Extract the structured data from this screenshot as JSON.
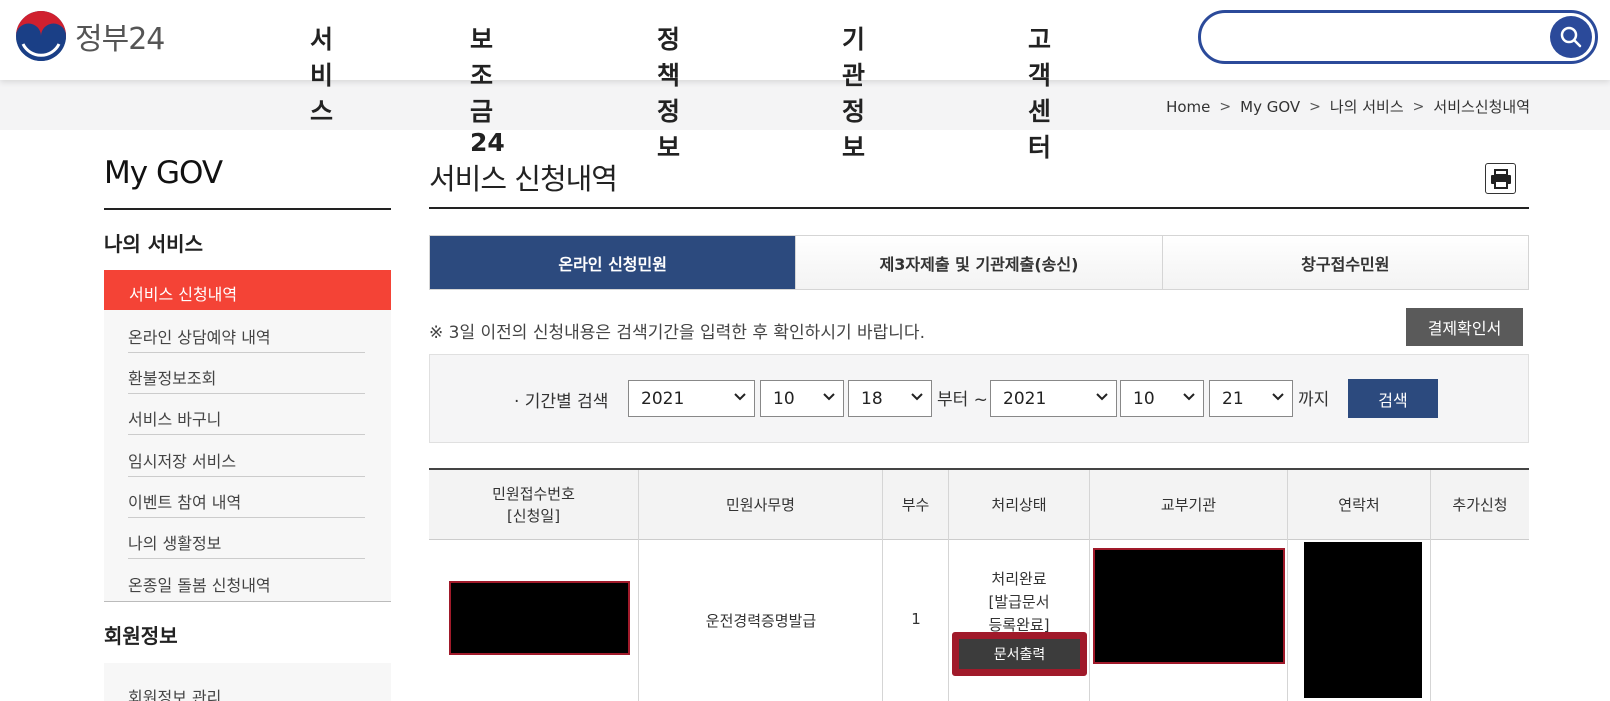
{
  "header": {
    "logo_text": "정부24",
    "nav": [
      "서비스",
      "보조금24",
      "정책정보",
      "기관정보",
      "고객센터"
    ],
    "search_placeholder": ""
  },
  "breadcrumb": [
    "Home",
    "My GOV",
    "나의 서비스",
    "서비스신청내역"
  ],
  "sidebar": {
    "title": "My GOV",
    "section1": "나의 서비스",
    "active_item": "서비스 신청내역",
    "items": [
      "온라인 상담예약 내역",
      "환불정보조회",
      "서비스 바구니",
      "임시저장 서비스",
      "이벤트 참여 내역",
      "나의 생활정보",
      "온종일 돌봄 신청내역"
    ],
    "section2": "회원정보",
    "section2_items": [
      "회원정보 관리"
    ]
  },
  "main": {
    "title": "서비스 신청내역",
    "tabs": [
      "온라인 신청민원",
      "제3자제출 및 기관제출(송신)",
      "창구접수민원"
    ],
    "notice": "※ 3일 이전의 신청내용은 검색기간을 입력한 후 확인하시기 바랍니다.",
    "pay_button": "결제확인서",
    "filter": {
      "label": "· 기간별 검색",
      "from_year": "2021",
      "from_month": "10",
      "from_day": "18",
      "from_word": "부터 ~",
      "to_year": "2021",
      "to_month": "10",
      "to_day": "21",
      "to_word": "까지",
      "search_button": "검색"
    },
    "table": {
      "headers": [
        "민원접수번호",
        "[신청일]",
        "민원사무명",
        "부수",
        "처리상태",
        "교부기관",
        "연락처",
        "추가신청"
      ],
      "row": {
        "service_name": "운전경력증명발급",
        "copies": "1",
        "status_line1": "처리완료",
        "status_line2": "[발급문서",
        "status_line3": "등록완료]",
        "print_button": "문서출력"
      }
    }
  },
  "colors": {
    "brand_blue": "#2b4a9a",
    "tab_active": "#2c4a7e",
    "sidebar_active": "#f44336",
    "highlight_red": "#a01a2a"
  }
}
